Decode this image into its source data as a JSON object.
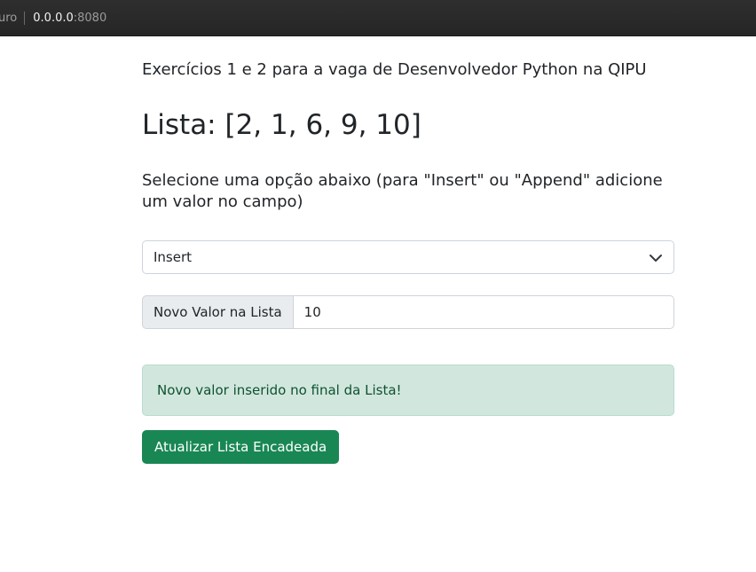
{
  "browser": {
    "security_text": "uro",
    "host": "0.0.0.0",
    "port": ":8080"
  },
  "page": {
    "subtitle": "Exercícios 1 e 2 para a vaga de Desenvolvedor Python na QIPU",
    "list_title": "Lista: [2, 1, 6, 9, 10]",
    "instructions": "Selecione uma opção abaixo (para \"Insert\" ou \"Append\" adicione um valor no campo)"
  },
  "form": {
    "operation_selected": "Insert",
    "value_label": "Novo Valor na Lista",
    "value_input": "10",
    "submit_label": "Atualizar Lista Encadeada"
  },
  "alert": {
    "message": "Novo valor inserido no final da Lista!"
  },
  "colors": {
    "success_button": "#198754",
    "alert_bg": "#d1e7dd",
    "alert_text": "#0f5132"
  }
}
